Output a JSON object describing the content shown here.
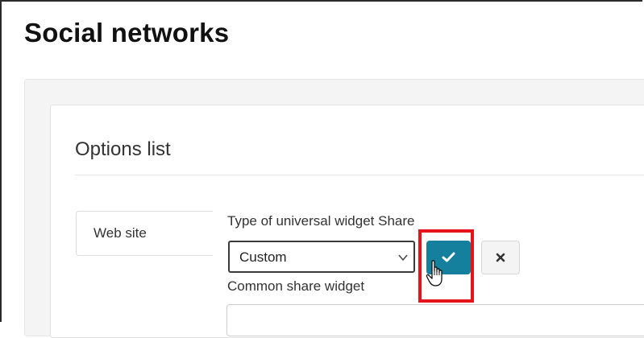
{
  "page": {
    "title": "Social networks"
  },
  "section": {
    "title": "Options list"
  },
  "side_tabs": [
    {
      "label": "Web site"
    }
  ],
  "form": {
    "widget_type_label": "Type of universal widget Share",
    "widget_type_value": "Custom",
    "common_widget_label": "Common share widget",
    "common_widget_value": ""
  },
  "colors": {
    "confirm_button": "#15809d",
    "highlight": "#e5141a"
  },
  "icons": {
    "confirm": "checkmark-icon",
    "cancel": "close-icon",
    "select": "chevron-down-icon",
    "cursor": "hand-pointer-icon"
  }
}
